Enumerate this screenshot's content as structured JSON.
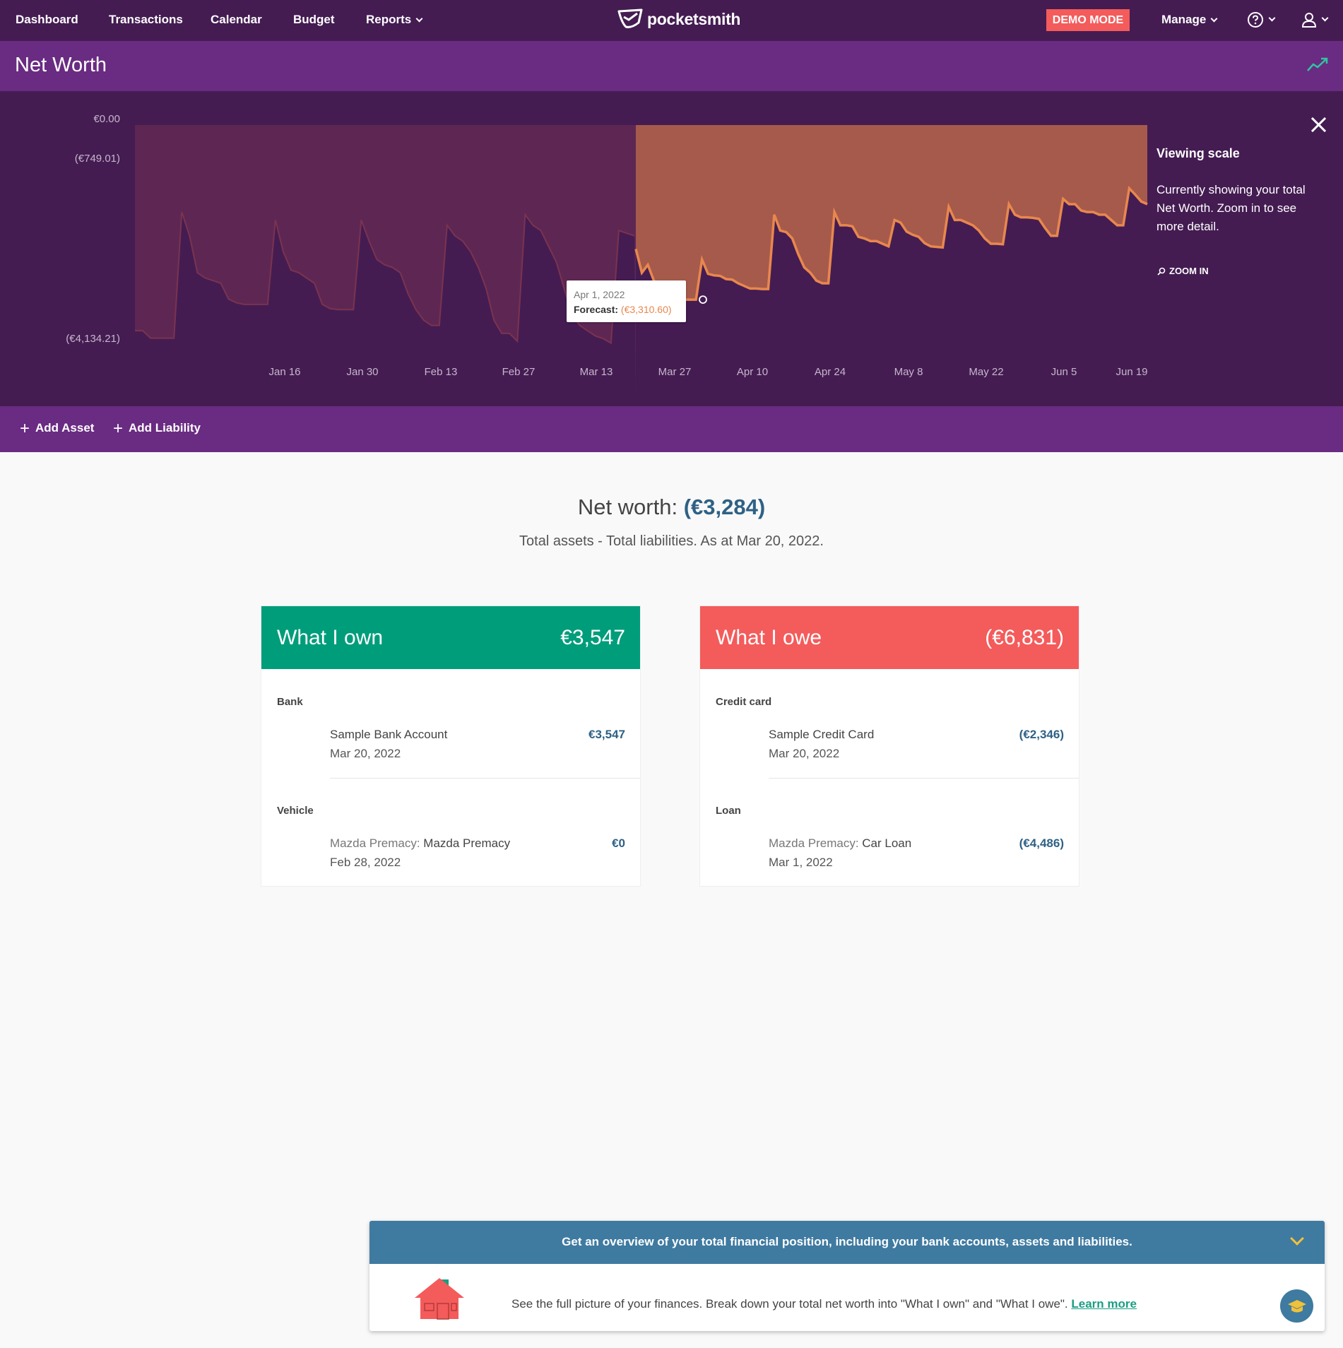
{
  "nav": {
    "items": [
      "Dashboard",
      "Transactions",
      "Calendar",
      "Budget",
      "Reports"
    ],
    "brand": "pocketsmith",
    "demo_badge": "DEMO MODE",
    "manage": "Manage"
  },
  "page": {
    "title": "Net Worth"
  },
  "chart_data": {
    "type": "area",
    "y_tick_labels": [
      "€0.00",
      "(€749.01)",
      "(€4,134.21)"
    ],
    "x_tick_labels": [
      "Jan 16",
      "Jan 30",
      "Feb 13",
      "Feb 27",
      "Mar 13",
      "Mar 27",
      "Apr 10",
      "Apr 24",
      "May 8",
      "May 22",
      "Jun 5",
      "Jun 19"
    ],
    "series": [
      {
        "kind": "actual",
        "values": [
          -3900,
          -3900,
          -4040,
          -4040,
          -4040,
          -4040,
          -1650,
          -2100,
          -2800,
          -2900,
          -2950,
          -3000,
          -3300,
          -3370,
          -3400,
          -3400,
          -3400,
          -3400,
          -1800,
          -2400,
          -2750,
          -2800,
          -2900,
          -3000,
          -3400,
          -3480,
          -3500,
          -3500,
          -3500,
          -1800,
          -2200,
          -2550,
          -2650,
          -2700,
          -2800,
          -3200,
          -3500,
          -3700,
          -3800,
          -3800,
          -1900,
          -2100,
          -2200,
          -2400,
          -2700,
          -3100,
          -3700,
          -3950,
          -3950,
          -4100,
          -1700,
          -1900,
          -2000,
          -2300,
          -2600,
          -3100,
          -3600,
          -3800,
          -3900,
          -4000,
          -4050,
          -4134,
          -2000,
          -2050,
          -2100
        ]
      },
      {
        "kind": "forecast",
        "values": [
          -2350,
          -2800,
          -2650,
          -2950,
          -3050,
          -3200,
          -3250,
          -3310,
          -3310,
          -3310,
          -3310,
          -2550,
          -2820,
          -2850,
          -2860,
          -2920,
          -2930,
          -3000,
          -3050,
          -3100,
          -3100,
          -3110,
          -3110,
          -1700,
          -2000,
          -2030,
          -2150,
          -2450,
          -2700,
          -2800,
          -2950,
          -3000,
          -3000,
          -1650,
          -1900,
          -1900,
          -1920,
          -2120,
          -2150,
          -2200,
          -2200,
          -2250,
          -2300,
          -1800,
          -1850,
          -2020,
          -2080,
          -2120,
          -2240,
          -2300,
          -2310,
          -2320,
          -1550,
          -1800,
          -1800,
          -1850,
          -1900,
          -2000,
          -2150,
          -2250,
          -2250,
          -2260,
          -1500,
          -1700,
          -1750,
          -1750,
          -1760,
          -1780,
          -1950,
          -2100,
          -2100,
          -1400,
          -1500,
          -1500,
          -1620,
          -1650,
          -1650,
          -1700,
          -1700,
          -1800,
          -1900,
          -1900,
          -1200,
          -1320,
          -1450,
          -1500
        ]
      }
    ],
    "tooltip": {
      "date": "Apr 1, 2022",
      "label": "Forecast:",
      "value": "(€3,310.60)"
    }
  },
  "sidebar": {
    "title": "Viewing scale",
    "description": "Currently showing your total Net Worth. Zoom in to see more detail.",
    "zoom_in": "ZOOM IN"
  },
  "actions": {
    "add_asset": "Add Asset",
    "add_liability": "Add Liability"
  },
  "summary": {
    "label": "Net worth:",
    "value": "(€3,284)",
    "subtitle": "Total assets - Total liabilities. As at Mar 20, 2022."
  },
  "own": {
    "title": "What I own",
    "total": "€3,547",
    "color": "#009d7b",
    "groups": [
      {
        "label": "Bank",
        "prefix": "",
        "name": "Sample Bank Account",
        "date": "Mar 20, 2022",
        "value": "€3,547"
      },
      {
        "label": "Vehicle",
        "prefix": "Mazda Premacy:",
        "name": "Mazda Premacy",
        "date": "Feb 28, 2022",
        "value": "€0"
      }
    ]
  },
  "owe": {
    "title": "What I owe",
    "total": "(€6,831)",
    "color": "#f45b5b",
    "groups": [
      {
        "label": "Credit card",
        "prefix": "",
        "name": "Sample Credit Card",
        "date": "Mar 20, 2022",
        "value": "(€2,346)"
      },
      {
        "label": "Loan",
        "prefix": "Mazda Premacy:",
        "name": "Car Loan",
        "date": "Mar 1, 2022",
        "value": "(€4,486)"
      }
    ]
  },
  "help": {
    "headline": "Get an overview of your total financial position, including your bank accounts, assets and liabilities.",
    "body": "See the full picture of your finances. Break down your total net worth into \"What I own\" and \"What I owe\".",
    "learn_more": "Learn more"
  }
}
